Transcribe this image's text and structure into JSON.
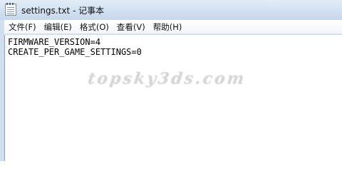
{
  "window": {
    "title": "settings.txt - 记事本",
    "app_icon": "notepad-icon"
  },
  "menubar": {
    "items": [
      "文件(F)",
      "编辑(E)",
      "格式(O)",
      "查看(V)",
      "帮助(H)"
    ]
  },
  "editor": {
    "lines": [
      "FIRMWARE_VERSION=4",
      "CREATE_PER_GAME_SETTINGS=0"
    ]
  },
  "watermark": "topsky3ds.com"
}
